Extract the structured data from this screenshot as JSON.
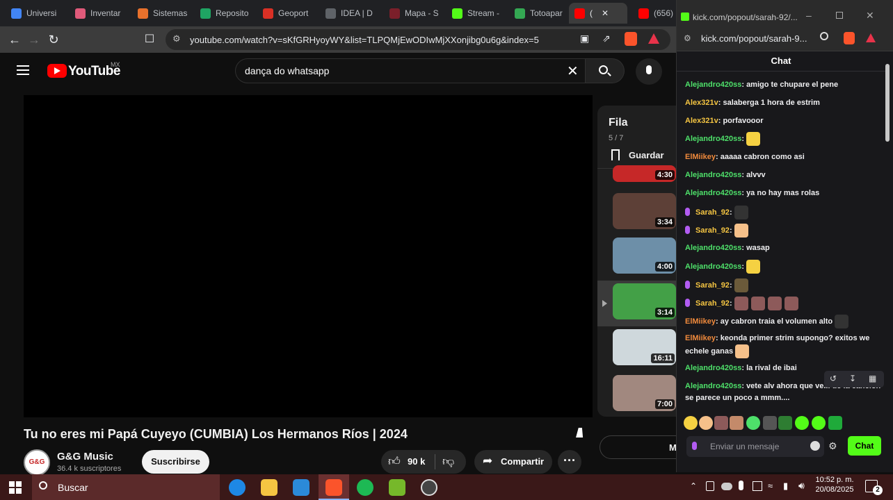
{
  "browser": {
    "tabs": [
      {
        "label": "Universi",
        "color": "#4285f4"
      },
      {
        "label": "Inventar",
        "color": "#e05a7a"
      },
      {
        "label": "Sistemas",
        "color": "#e8712c"
      },
      {
        "label": "Reposito",
        "color": "#1fa463"
      },
      {
        "label": "Geoport",
        "color": "#d93025"
      },
      {
        "label": "IDEA | D",
        "color": "#5f6368"
      },
      {
        "label": "Mapa - S",
        "color": "#7b1f2a"
      },
      {
        "label": "Stream -",
        "color": "#53fc18"
      },
      {
        "label": "Totoapar",
        "color": "#34a853"
      },
      {
        "label": "(",
        "color": "#ff0000"
      },
      {
        "label": "(656)",
        "color": "#ff0000"
      }
    ],
    "url": "youtube.com/watch?v=sKfGRHyoyWY&list=TLPQMjEwODIwMjXXonjibg0u6g&index=5",
    "popup_url_short": "kick.com/popout/sarah-92/...",
    "popup_url": "kick.com/popout/sarah-9..."
  },
  "youtube": {
    "logo": "YouTube",
    "region": "MX",
    "search_query": "dança do whatsapp",
    "video_title": "Tu no eres mi Papá Cuyeyo (CUMBIA) Los Hermanos Ríos | 2024",
    "channel_name": "G&G Music",
    "channel_avatar": "G&G",
    "subscribers": "36.4 k suscriptores",
    "subscribe_label": "Suscribirse",
    "likes": "90 k",
    "share_label": "Compartir",
    "more_label": "M",
    "queue": {
      "title": "Fila",
      "position": "5 / 7",
      "save_label": "Guardar",
      "items": [
        {
          "duration": "4:30",
          "color": "#c62828"
        },
        {
          "duration": "3:34",
          "color": "#5d4037"
        },
        {
          "duration": "4:00",
          "color": "#6d8fa8"
        },
        {
          "duration": "3:14",
          "color": "#43a047"
        },
        {
          "duration": "16:11",
          "color": "#cfd8dc"
        },
        {
          "duration": "7:00",
          "color": "#a1887f"
        }
      ]
    }
  },
  "chat": {
    "title": "Chat",
    "input_placeholder": "Enviar un mensaje",
    "send_label": "Chat",
    "messages": [
      {
        "user": "Alejandro420ss",
        "color": "#4ee06a",
        "text": "amigo te chupare el pene",
        "mic": false,
        "emotes": 0
      },
      {
        "user": "Alex321v",
        "color": "#f5c542",
        "text": "salaberga 1 hora de estrim",
        "mic": false,
        "emotes": 0
      },
      {
        "user": "Alex321v",
        "color": "#f5c542",
        "text": "porfavooor",
        "mic": false,
        "emotes": 0
      },
      {
        "user": "Alejandro420ss",
        "color": "#4ee06a",
        "text": "",
        "mic": false,
        "emotes": 1
      },
      {
        "user": "ElMiikey",
        "color": "#f08a3c",
        "text": "aaaaa cabron como asi",
        "mic": false,
        "emotes": 0
      },
      {
        "user": "Alejandro420ss",
        "color": "#4ee06a",
        "text": "alvvv",
        "mic": false,
        "emotes": 0
      },
      {
        "user": "Alejandro420ss",
        "color": "#4ee06a",
        "text": "ya no hay mas rolas",
        "mic": false,
        "emotes": 0
      },
      {
        "user": "Sarah_92",
        "color": "#f5c542",
        "text": "",
        "mic": true,
        "emotes": 1
      },
      {
        "user": "Sarah_92",
        "color": "#f5c542",
        "text": "",
        "mic": true,
        "emotes": 1
      },
      {
        "user": "Alejandro420ss",
        "color": "#4ee06a",
        "text": "wasap",
        "mic": false,
        "emotes": 0
      },
      {
        "user": "Alejandro420ss",
        "color": "#4ee06a",
        "text": "",
        "mic": false,
        "emotes": 1
      },
      {
        "user": "Sarah_92",
        "color": "#f5c542",
        "text": "",
        "mic": true,
        "emotes": 1
      },
      {
        "user": "Sarah_92",
        "color": "#f5c542",
        "text": "",
        "mic": true,
        "emotes": 4
      },
      {
        "user": "ElMiikey",
        "color": "#f08a3c",
        "text": "ay cabron traia el volumen alto",
        "mic": false,
        "emotes": 1
      },
      {
        "user": "ElMiikey",
        "color": "#f08a3c",
        "text": "keonda primer strim supongo? exitos we echele ganas",
        "mic": false,
        "emotes": 1
      },
      {
        "user": "Alejandro420ss",
        "color": "#4ee06a",
        "text": "la rival de ibai",
        "mic": false,
        "emotes": 0
      },
      {
        "user": "Alejandro420ss",
        "color": "#4ee06a",
        "text": "vete alv ahora que ve... de la cancion se parece un poco a mmm....",
        "mic": false,
        "emotes": 0
      }
    ]
  },
  "taskbar": {
    "search_label": "Buscar",
    "time": "10:52 p. m.",
    "date": "20/08/2025",
    "notifications": "2"
  }
}
